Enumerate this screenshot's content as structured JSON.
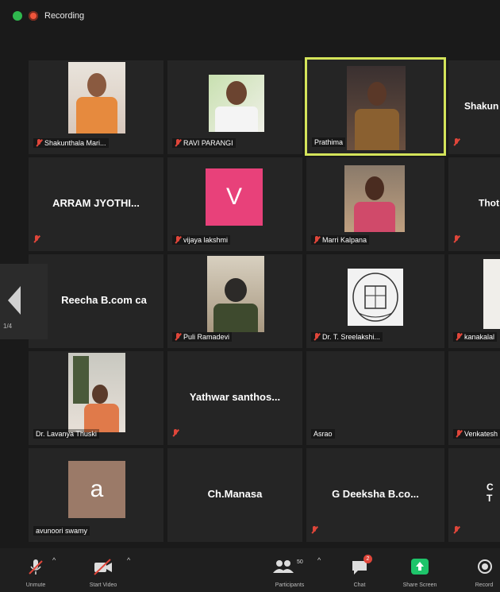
{
  "recording": {
    "label": "Recording"
  },
  "tiles": [
    {
      "name": "Shakunthala Mari...",
      "big": ""
    },
    {
      "name": "RAVI PARANGI",
      "big": ""
    },
    {
      "name": "Prathima",
      "big": ""
    },
    {
      "name": "",
      "big": "Shakun"
    },
    {
      "name": "",
      "big": "ARRAM JYOTHI..."
    },
    {
      "name": "vijaya lakshmi",
      "big": "",
      "avatar": "V"
    },
    {
      "name": "Marri Kalpana",
      "big": ""
    },
    {
      "name": "",
      "big": "Thot"
    },
    {
      "name": "",
      "big": "Reecha B.com ca"
    },
    {
      "name": "Puli Ramadevi",
      "big": ""
    },
    {
      "name": "Dr. T. Sreelakshi...",
      "big": ""
    },
    {
      "name": "kanakalal",
      "big": ""
    },
    {
      "name": "Dr. Lavanya Thuski",
      "big": ""
    },
    {
      "name": "",
      "big": "Yathwar santhos..."
    },
    {
      "name": "Asrao",
      "big": ""
    },
    {
      "name": "Venkatesh",
      "big": ""
    },
    {
      "name": "avunoori swamy",
      "big": "",
      "avatar": "a"
    },
    {
      "name": "",
      "big": "Ch.Manasa"
    },
    {
      "name": "",
      "big": "G Deeksha B.co..."
    },
    {
      "name": "",
      "big": "C T"
    }
  ],
  "page_indicator": "1/4",
  "toolbar": {
    "unmute": "Unmute",
    "start_video": "Start Video",
    "participants": "Participants",
    "participants_count": "50",
    "chat": "Chat",
    "chat_badge": "2",
    "share_screen": "Share Screen",
    "record": "Record"
  },
  "colors": {
    "active_border": "#d4e45a",
    "avatar_v": "#e8417a",
    "avatar_a": "#9b7a68",
    "share_green": "#1ec46a"
  }
}
